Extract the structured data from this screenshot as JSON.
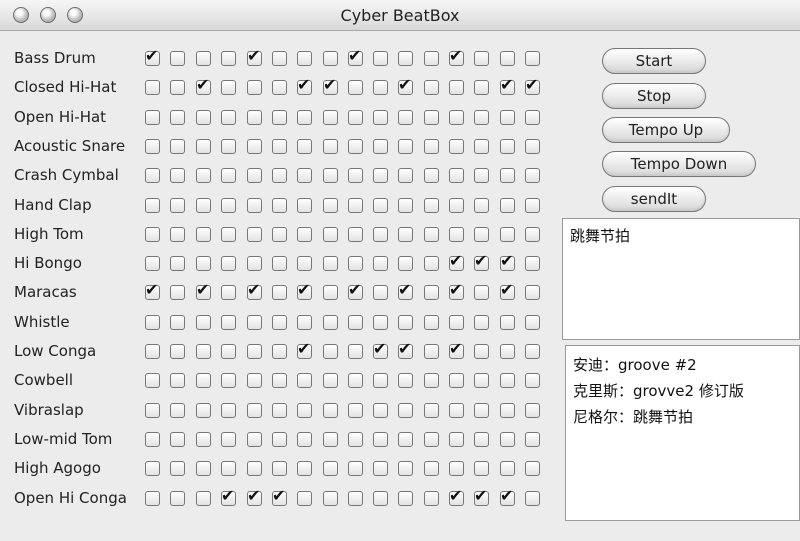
{
  "window": {
    "title": "Cyber BeatBox"
  },
  "instruments": [
    {
      "name": "Bass Drum",
      "steps": [
        1,
        0,
        0,
        0,
        1,
        0,
        0,
        0,
        1,
        0,
        0,
        0,
        1,
        0,
        0,
        0
      ]
    },
    {
      "name": "Closed Hi-Hat",
      "steps": [
        0,
        0,
        1,
        0,
        0,
        0,
        1,
        1,
        0,
        0,
        1,
        0,
        0,
        0,
        1,
        1
      ]
    },
    {
      "name": "Open Hi-Hat",
      "steps": [
        0,
        0,
        0,
        0,
        0,
        0,
        0,
        0,
        0,
        0,
        0,
        0,
        0,
        0,
        0,
        0
      ]
    },
    {
      "name": "Acoustic Snare",
      "steps": [
        0,
        0,
        0,
        0,
        0,
        0,
        0,
        0,
        0,
        0,
        0,
        0,
        0,
        0,
        0,
        0
      ]
    },
    {
      "name": "Crash Cymbal",
      "steps": [
        0,
        0,
        0,
        0,
        0,
        0,
        0,
        0,
        0,
        0,
        0,
        0,
        0,
        0,
        0,
        0
      ]
    },
    {
      "name": "Hand Clap",
      "steps": [
        0,
        0,
        0,
        0,
        0,
        0,
        0,
        0,
        0,
        0,
        0,
        0,
        0,
        0,
        0,
        0
      ]
    },
    {
      "name": "High Tom",
      "steps": [
        0,
        0,
        0,
        0,
        0,
        0,
        0,
        0,
        0,
        0,
        0,
        0,
        0,
        0,
        0,
        0
      ]
    },
    {
      "name": "Hi Bongo",
      "steps": [
        0,
        0,
        0,
        0,
        0,
        0,
        0,
        0,
        0,
        0,
        0,
        0,
        1,
        1,
        1,
        0
      ]
    },
    {
      "name": "Maracas",
      "steps": [
        1,
        0,
        1,
        0,
        1,
        0,
        1,
        0,
        1,
        0,
        1,
        0,
        1,
        0,
        1,
        0
      ]
    },
    {
      "name": "Whistle",
      "steps": [
        0,
        0,
        0,
        0,
        0,
        0,
        0,
        0,
        0,
        0,
        0,
        0,
        0,
        0,
        0,
        0
      ]
    },
    {
      "name": "Low Conga",
      "steps": [
        0,
        0,
        0,
        0,
        0,
        0,
        1,
        0,
        0,
        1,
        1,
        0,
        1,
        0,
        0,
        0
      ]
    },
    {
      "name": "Cowbell",
      "steps": [
        0,
        0,
        0,
        0,
        0,
        0,
        0,
        0,
        0,
        0,
        0,
        0,
        0,
        0,
        0,
        0
      ]
    },
    {
      "name": "Vibraslap",
      "steps": [
        0,
        0,
        0,
        0,
        0,
        0,
        0,
        0,
        0,
        0,
        0,
        0,
        0,
        0,
        0,
        0
      ]
    },
    {
      "name": "Low-mid Tom",
      "steps": [
        0,
        0,
        0,
        0,
        0,
        0,
        0,
        0,
        0,
        0,
        0,
        0,
        0,
        0,
        0,
        0
      ]
    },
    {
      "name": "High Agogo",
      "steps": [
        0,
        0,
        0,
        0,
        0,
        0,
        0,
        0,
        0,
        0,
        0,
        0,
        0,
        0,
        0,
        0
      ]
    },
    {
      "name": "Open Hi Conga",
      "steps": [
        0,
        0,
        0,
        1,
        1,
        1,
        0,
        0,
        0,
        0,
        0,
        0,
        1,
        1,
        1,
        0
      ]
    }
  ],
  "buttons": {
    "start": "Start",
    "stop": "Stop",
    "tempo_up": "Tempo Up",
    "tempo_down": "Tempo Down",
    "send": "sendIt"
  },
  "user_message": "跳舞节拍",
  "incoming_messages": [
    "安迪：groove #2",
    "克里斯：grovve2 修订版",
    "尼格尔：跳舞节拍"
  ]
}
